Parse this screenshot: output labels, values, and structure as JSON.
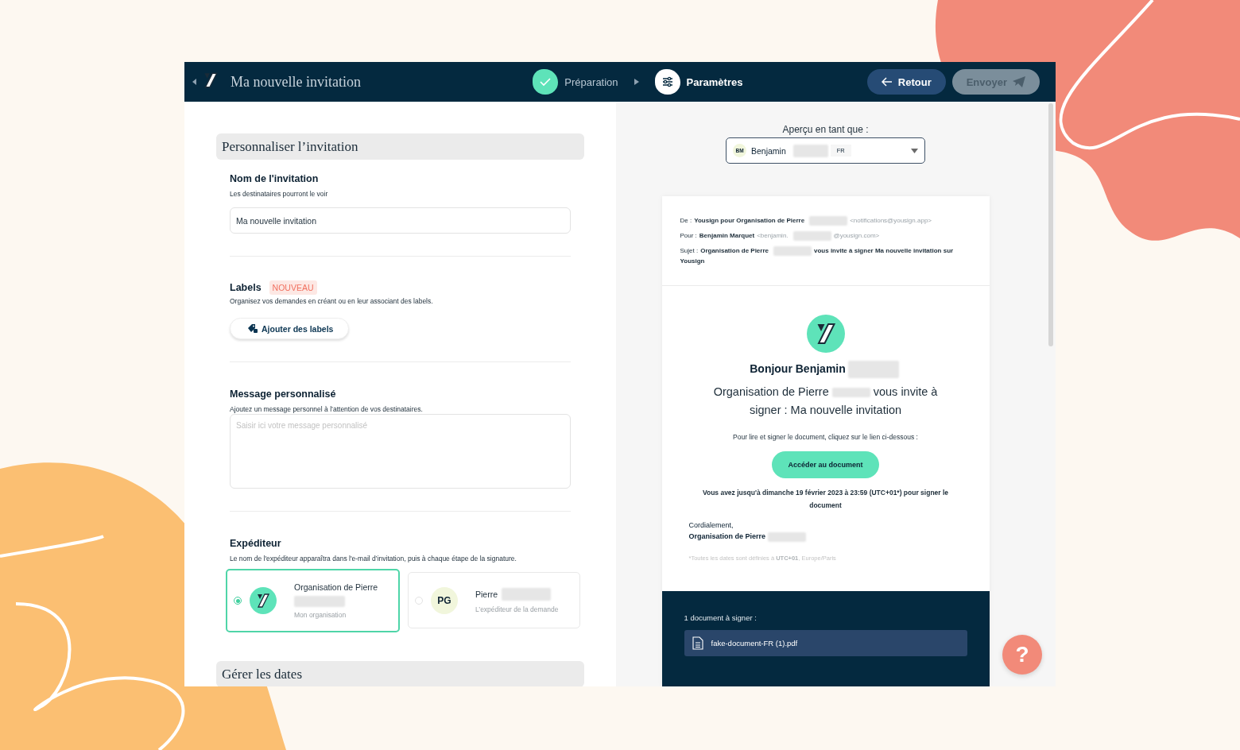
{
  "header": {
    "title": "Ma nouvelle invitation",
    "steps": [
      {
        "label": "Préparation",
        "done": true,
        "selected": false
      },
      {
        "label": "Paramètres",
        "done": false,
        "selected": true
      }
    ],
    "buttons": [
      {
        "label": "Retour",
        "kind": "back",
        "disabled": false
      },
      {
        "label": "Envoyer",
        "kind": "send",
        "disabled": true
      }
    ]
  },
  "customize": {
    "title": "Personnaliser l’invitation",
    "name_field": {
      "label": "Nom de l'invitation",
      "hint": "Les destinataires pourront le voir",
      "value": "Ma nouvelle invitation"
    },
    "labels": {
      "label": "Labels",
      "badge": "NOUVEAU",
      "hint": "Organisez vos demandes en créant ou en leur associant des labels.",
      "button": "Ajouter des labels"
    },
    "message": {
      "label": "Message personnalisé",
      "hint": "Ajoutez un message personnel à l’attention de vos destinataires.",
      "placeholder": "Saisir ici votre message personnalisé"
    },
    "sender": {
      "label": "Expéditeur",
      "hint": "Le nom de l'expéditeur apparaîtra dans l'e-mail d’invitation, puis à chaque étape de la signature.",
      "options": [
        {
          "name": "Organisation de Pierre",
          "subtitle": "Mon organisation",
          "kind": "logo",
          "selected": true
        },
        {
          "name": "Pierre",
          "initials": "PG",
          "subtitle": "L’expéditeur de la demande",
          "kind": "initials",
          "selected": false
        }
      ]
    }
  },
  "dates": {
    "title": "Gérer les dates"
  },
  "preview": {
    "label": "Aperçu en tant que :",
    "recipient": {
      "initials": "BM",
      "name": "Benjamin",
      "lang": "FR"
    },
    "email": {
      "headers": [
        [
          {
            "kind": "label",
            "text": "De :"
          },
          {
            "kind": "bold",
            "text": "Yousign pour Organisation de Pierre"
          },
          {
            "kind": "redacted"
          },
          {
            "kind": "muted",
            "text": "<notifications@yousign.app>"
          }
        ],
        [
          {
            "kind": "label",
            "text": "Pour :"
          },
          {
            "kind": "bold",
            "text": "Benjamin Marquet"
          },
          {
            "kind": "muted",
            "text": "<benjamin."
          },
          {
            "kind": "redacted"
          },
          {
            "kind": "muted",
            "text": "@yousign.com>"
          }
        ],
        [
          {
            "kind": "label",
            "text": "Sujet :"
          },
          {
            "kind": "bold",
            "text": "Organisation de Pierre"
          },
          {
            "kind": "redacted"
          },
          {
            "kind": "bold",
            "text": "vous invite à signer Ma nouvelle invitation sur"
          },
          {
            "kind": "bold",
            "text": "Yousign"
          }
        ]
      ],
      "greeting": [
        {
          "kind": "text",
          "text": "Bonjour Benjamin"
        },
        {
          "kind": "redacted"
        }
      ],
      "invite": [
        {
          "kind": "text",
          "text": "Organisation de Pierre"
        },
        {
          "kind": "redacted"
        },
        {
          "kind": "text",
          "text": "vous invite à"
        },
        {
          "kind": "text",
          "text": "signer : Ma nouvelle invitation"
        }
      ],
      "instruction": "Pour lire et signer le document, cliquez sur le lien ci-dessous :",
      "button": "Accéder au document",
      "deadline": "Vous avez jusqu'à dimanche 19 février 2023 à 23:59 (UTC+01*) pour signer le document",
      "closing": "Cordialement,",
      "signature": [
        {
          "kind": "text",
          "text": "Organisation de Pierre"
        },
        {
          "kind": "redacted"
        }
      ],
      "footnote": "*Toutes les dates sont définies à **UTC+01**, Europe/Paris",
      "documents_label": "1 document à signer :",
      "documents": [
        "fake-document-FR (1).pdf"
      ]
    }
  },
  "help": "?"
}
